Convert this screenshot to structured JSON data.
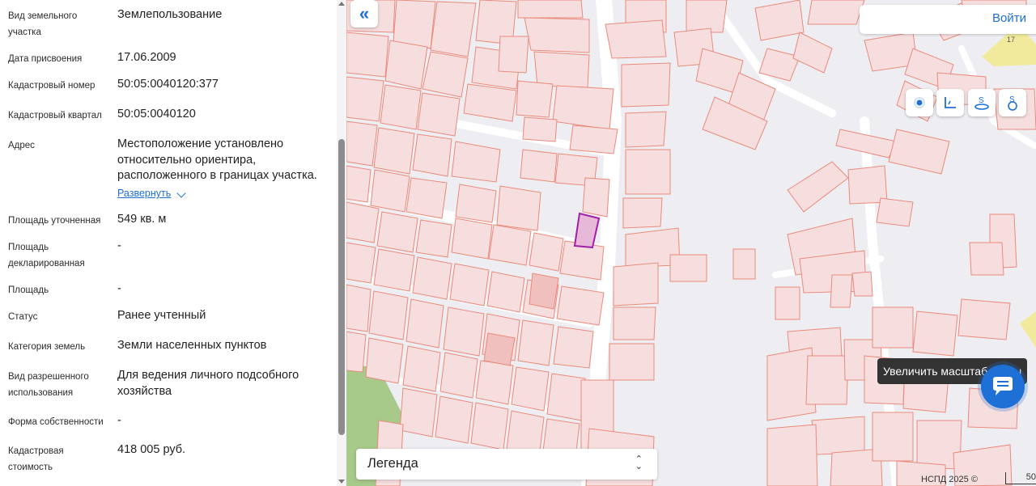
{
  "info": {
    "land_type_label": "Вид земельного участка",
    "land_type_value": "Землепользование",
    "assign_date_label": "Дата присвоения",
    "assign_date_value": "17.06.2009",
    "cad_number_label": "Кадастровый номер",
    "cad_number_value": "50:05:0040120:377",
    "cad_quarter_label": "Кадастровый квартал",
    "cad_quarter_value": "50:05:0040120",
    "address_label": "Адрес",
    "address_value": "Местоположение установлено относительно ориентира, расположенного в границах участка.",
    "address_expand": "Развернуть",
    "area_refined_label": "Площадь уточненная",
    "area_refined_value": "549 кв. м",
    "area_declared_label": "Площадь декларированная",
    "area_declared_value": "-",
    "area_label": "Площадь",
    "area_value": "-",
    "status_label": "Статус",
    "status_value": "Ранее учтенный",
    "category_label": "Категория земель",
    "category_value": "Земли населенных пунктов",
    "permitted_use_label": "Вид разрешенного использования",
    "permitted_use_value": "Для ведения личного подсобного хозяйства",
    "ownership_label": "Форма собственности",
    "ownership_value": "-",
    "cad_value_label": "Кадастровая стоимость",
    "cad_value_value": "418 005 руб."
  },
  "map": {
    "login_label": "Войти",
    "house_number": "17",
    "tooltip": "Увеличить масштаб карты",
    "legend_label": "Легенда",
    "copyright": "НСПД 2025 ©",
    "scale_label": "50"
  },
  "icons": {
    "collapse": "double-chevron-left-icon",
    "tools": [
      "locate-point-icon",
      "measure-distance-icon",
      "measure-area-icon",
      "measure-area-circle-icon"
    ],
    "chat": "chat-bubble-icon"
  },
  "colors": {
    "accent": "#1e6fd6",
    "parcel_fill": "#f6dede",
    "parcel_stroke": "#ea8a7c",
    "selected_parcel": "#a020a8"
  }
}
